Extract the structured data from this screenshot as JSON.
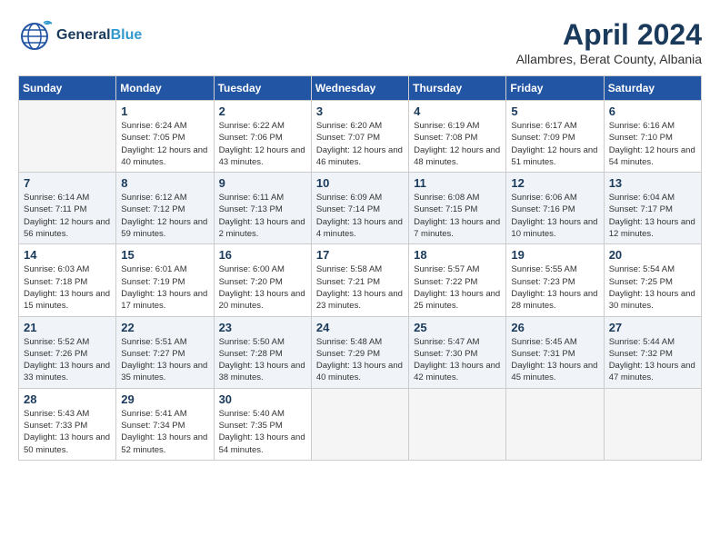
{
  "header": {
    "logo_general": "General",
    "logo_blue": "Blue",
    "month_year": "April 2024",
    "location": "Allambres, Berat County, Albania"
  },
  "weekdays": [
    "Sunday",
    "Monday",
    "Tuesday",
    "Wednesday",
    "Thursday",
    "Friday",
    "Saturday"
  ],
  "weeks": [
    [
      {
        "day": "",
        "sunrise": "",
        "sunset": "",
        "daylight": ""
      },
      {
        "day": "1",
        "sunrise": "Sunrise: 6:24 AM",
        "sunset": "Sunset: 7:05 PM",
        "daylight": "Daylight: 12 hours and 40 minutes."
      },
      {
        "day": "2",
        "sunrise": "Sunrise: 6:22 AM",
        "sunset": "Sunset: 7:06 PM",
        "daylight": "Daylight: 12 hours and 43 minutes."
      },
      {
        "day": "3",
        "sunrise": "Sunrise: 6:20 AM",
        "sunset": "Sunset: 7:07 PM",
        "daylight": "Daylight: 12 hours and 46 minutes."
      },
      {
        "day": "4",
        "sunrise": "Sunrise: 6:19 AM",
        "sunset": "Sunset: 7:08 PM",
        "daylight": "Daylight: 12 hours and 48 minutes."
      },
      {
        "day": "5",
        "sunrise": "Sunrise: 6:17 AM",
        "sunset": "Sunset: 7:09 PM",
        "daylight": "Daylight: 12 hours and 51 minutes."
      },
      {
        "day": "6",
        "sunrise": "Sunrise: 6:16 AM",
        "sunset": "Sunset: 7:10 PM",
        "daylight": "Daylight: 12 hours and 54 minutes."
      }
    ],
    [
      {
        "day": "7",
        "sunrise": "Sunrise: 6:14 AM",
        "sunset": "Sunset: 7:11 PM",
        "daylight": "Daylight: 12 hours and 56 minutes."
      },
      {
        "day": "8",
        "sunrise": "Sunrise: 6:12 AM",
        "sunset": "Sunset: 7:12 PM",
        "daylight": "Daylight: 12 hours and 59 minutes."
      },
      {
        "day": "9",
        "sunrise": "Sunrise: 6:11 AM",
        "sunset": "Sunset: 7:13 PM",
        "daylight": "Daylight: 13 hours and 2 minutes."
      },
      {
        "day": "10",
        "sunrise": "Sunrise: 6:09 AM",
        "sunset": "Sunset: 7:14 PM",
        "daylight": "Daylight: 13 hours and 4 minutes."
      },
      {
        "day": "11",
        "sunrise": "Sunrise: 6:08 AM",
        "sunset": "Sunset: 7:15 PM",
        "daylight": "Daylight: 13 hours and 7 minutes."
      },
      {
        "day": "12",
        "sunrise": "Sunrise: 6:06 AM",
        "sunset": "Sunset: 7:16 PM",
        "daylight": "Daylight: 13 hours and 10 minutes."
      },
      {
        "day": "13",
        "sunrise": "Sunrise: 6:04 AM",
        "sunset": "Sunset: 7:17 PM",
        "daylight": "Daylight: 13 hours and 12 minutes."
      }
    ],
    [
      {
        "day": "14",
        "sunrise": "Sunrise: 6:03 AM",
        "sunset": "Sunset: 7:18 PM",
        "daylight": "Daylight: 13 hours and 15 minutes."
      },
      {
        "day": "15",
        "sunrise": "Sunrise: 6:01 AM",
        "sunset": "Sunset: 7:19 PM",
        "daylight": "Daylight: 13 hours and 17 minutes."
      },
      {
        "day": "16",
        "sunrise": "Sunrise: 6:00 AM",
        "sunset": "Sunset: 7:20 PM",
        "daylight": "Daylight: 13 hours and 20 minutes."
      },
      {
        "day": "17",
        "sunrise": "Sunrise: 5:58 AM",
        "sunset": "Sunset: 7:21 PM",
        "daylight": "Daylight: 13 hours and 23 minutes."
      },
      {
        "day": "18",
        "sunrise": "Sunrise: 5:57 AM",
        "sunset": "Sunset: 7:22 PM",
        "daylight": "Daylight: 13 hours and 25 minutes."
      },
      {
        "day": "19",
        "sunrise": "Sunrise: 5:55 AM",
        "sunset": "Sunset: 7:23 PM",
        "daylight": "Daylight: 13 hours and 28 minutes."
      },
      {
        "day": "20",
        "sunrise": "Sunrise: 5:54 AM",
        "sunset": "Sunset: 7:25 PM",
        "daylight": "Daylight: 13 hours and 30 minutes."
      }
    ],
    [
      {
        "day": "21",
        "sunrise": "Sunrise: 5:52 AM",
        "sunset": "Sunset: 7:26 PM",
        "daylight": "Daylight: 13 hours and 33 minutes."
      },
      {
        "day": "22",
        "sunrise": "Sunrise: 5:51 AM",
        "sunset": "Sunset: 7:27 PM",
        "daylight": "Daylight: 13 hours and 35 minutes."
      },
      {
        "day": "23",
        "sunrise": "Sunrise: 5:50 AM",
        "sunset": "Sunset: 7:28 PM",
        "daylight": "Daylight: 13 hours and 38 minutes."
      },
      {
        "day": "24",
        "sunrise": "Sunrise: 5:48 AM",
        "sunset": "Sunset: 7:29 PM",
        "daylight": "Daylight: 13 hours and 40 minutes."
      },
      {
        "day": "25",
        "sunrise": "Sunrise: 5:47 AM",
        "sunset": "Sunset: 7:30 PM",
        "daylight": "Daylight: 13 hours and 42 minutes."
      },
      {
        "day": "26",
        "sunrise": "Sunrise: 5:45 AM",
        "sunset": "Sunset: 7:31 PM",
        "daylight": "Daylight: 13 hours and 45 minutes."
      },
      {
        "day": "27",
        "sunrise": "Sunrise: 5:44 AM",
        "sunset": "Sunset: 7:32 PM",
        "daylight": "Daylight: 13 hours and 47 minutes."
      }
    ],
    [
      {
        "day": "28",
        "sunrise": "Sunrise: 5:43 AM",
        "sunset": "Sunset: 7:33 PM",
        "daylight": "Daylight: 13 hours and 50 minutes."
      },
      {
        "day": "29",
        "sunrise": "Sunrise: 5:41 AM",
        "sunset": "Sunset: 7:34 PM",
        "daylight": "Daylight: 13 hours and 52 minutes."
      },
      {
        "day": "30",
        "sunrise": "Sunrise: 5:40 AM",
        "sunset": "Sunset: 7:35 PM",
        "daylight": "Daylight: 13 hours and 54 minutes."
      },
      {
        "day": "",
        "sunrise": "",
        "sunset": "",
        "daylight": ""
      },
      {
        "day": "",
        "sunrise": "",
        "sunset": "",
        "daylight": ""
      },
      {
        "day": "",
        "sunrise": "",
        "sunset": "",
        "daylight": ""
      },
      {
        "day": "",
        "sunrise": "",
        "sunset": "",
        "daylight": ""
      }
    ]
  ]
}
